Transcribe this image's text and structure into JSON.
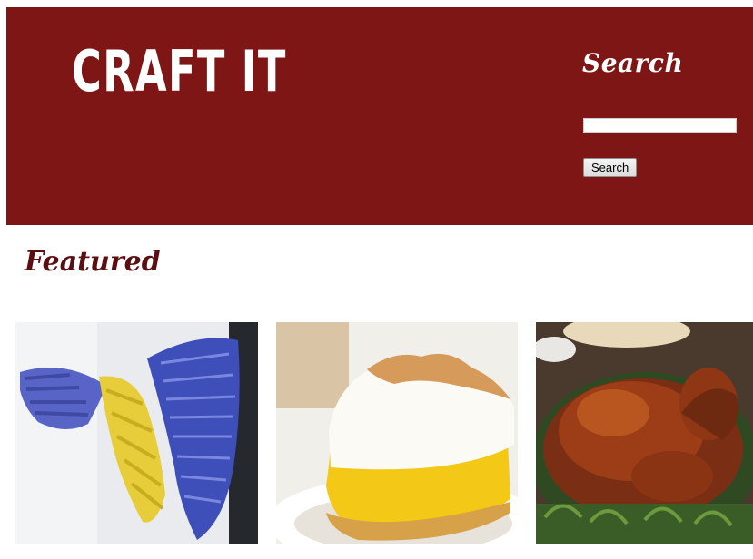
{
  "header": {
    "site_title": "CRAFT IT",
    "brand_color": "#7f1616"
  },
  "search": {
    "title": "Search",
    "input_value": "",
    "button_label": "Search"
  },
  "featured": {
    "title": "Featured",
    "items": [
      {
        "image": "paper-wings-craft-photo"
      },
      {
        "image": "lemon-meringue-pie-photo"
      },
      {
        "image": "roast-turkey-photo"
      }
    ]
  }
}
